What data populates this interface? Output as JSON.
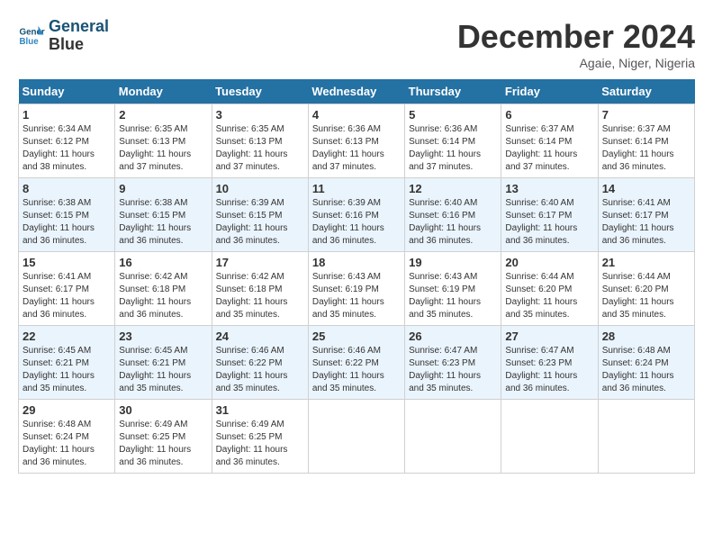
{
  "header": {
    "logo_line1": "General",
    "logo_line2": "Blue",
    "month_title": "December 2024",
    "location": "Agaie, Niger, Nigeria"
  },
  "weekdays": [
    "Sunday",
    "Monday",
    "Tuesday",
    "Wednesday",
    "Thursday",
    "Friday",
    "Saturday"
  ],
  "weeks": [
    [
      {
        "day": "1",
        "sunrise": "6:34 AM",
        "sunset": "6:12 PM",
        "daylight": "11 hours and 38 minutes."
      },
      {
        "day": "2",
        "sunrise": "6:35 AM",
        "sunset": "6:13 PM",
        "daylight": "11 hours and 37 minutes."
      },
      {
        "day": "3",
        "sunrise": "6:35 AM",
        "sunset": "6:13 PM",
        "daylight": "11 hours and 37 minutes."
      },
      {
        "day": "4",
        "sunrise": "6:36 AM",
        "sunset": "6:13 PM",
        "daylight": "11 hours and 37 minutes."
      },
      {
        "day": "5",
        "sunrise": "6:36 AM",
        "sunset": "6:14 PM",
        "daylight": "11 hours and 37 minutes."
      },
      {
        "day": "6",
        "sunrise": "6:37 AM",
        "sunset": "6:14 PM",
        "daylight": "11 hours and 37 minutes."
      },
      {
        "day": "7",
        "sunrise": "6:37 AM",
        "sunset": "6:14 PM",
        "daylight": "11 hours and 36 minutes."
      }
    ],
    [
      {
        "day": "8",
        "sunrise": "6:38 AM",
        "sunset": "6:15 PM",
        "daylight": "11 hours and 36 minutes."
      },
      {
        "day": "9",
        "sunrise": "6:38 AM",
        "sunset": "6:15 PM",
        "daylight": "11 hours and 36 minutes."
      },
      {
        "day": "10",
        "sunrise": "6:39 AM",
        "sunset": "6:15 PM",
        "daylight": "11 hours and 36 minutes."
      },
      {
        "day": "11",
        "sunrise": "6:39 AM",
        "sunset": "6:16 PM",
        "daylight": "11 hours and 36 minutes."
      },
      {
        "day": "12",
        "sunrise": "6:40 AM",
        "sunset": "6:16 PM",
        "daylight": "11 hours and 36 minutes."
      },
      {
        "day": "13",
        "sunrise": "6:40 AM",
        "sunset": "6:17 PM",
        "daylight": "11 hours and 36 minutes."
      },
      {
        "day": "14",
        "sunrise": "6:41 AM",
        "sunset": "6:17 PM",
        "daylight": "11 hours and 36 minutes."
      }
    ],
    [
      {
        "day": "15",
        "sunrise": "6:41 AM",
        "sunset": "6:17 PM",
        "daylight": "11 hours and 36 minutes."
      },
      {
        "day": "16",
        "sunrise": "6:42 AM",
        "sunset": "6:18 PM",
        "daylight": "11 hours and 36 minutes."
      },
      {
        "day": "17",
        "sunrise": "6:42 AM",
        "sunset": "6:18 PM",
        "daylight": "11 hours and 35 minutes."
      },
      {
        "day": "18",
        "sunrise": "6:43 AM",
        "sunset": "6:19 PM",
        "daylight": "11 hours and 35 minutes."
      },
      {
        "day": "19",
        "sunrise": "6:43 AM",
        "sunset": "6:19 PM",
        "daylight": "11 hours and 35 minutes."
      },
      {
        "day": "20",
        "sunrise": "6:44 AM",
        "sunset": "6:20 PM",
        "daylight": "11 hours and 35 minutes."
      },
      {
        "day": "21",
        "sunrise": "6:44 AM",
        "sunset": "6:20 PM",
        "daylight": "11 hours and 35 minutes."
      }
    ],
    [
      {
        "day": "22",
        "sunrise": "6:45 AM",
        "sunset": "6:21 PM",
        "daylight": "11 hours and 35 minutes."
      },
      {
        "day": "23",
        "sunrise": "6:45 AM",
        "sunset": "6:21 PM",
        "daylight": "11 hours and 35 minutes."
      },
      {
        "day": "24",
        "sunrise": "6:46 AM",
        "sunset": "6:22 PM",
        "daylight": "11 hours and 35 minutes."
      },
      {
        "day": "25",
        "sunrise": "6:46 AM",
        "sunset": "6:22 PM",
        "daylight": "11 hours and 35 minutes."
      },
      {
        "day": "26",
        "sunrise": "6:47 AM",
        "sunset": "6:23 PM",
        "daylight": "11 hours and 35 minutes."
      },
      {
        "day": "27",
        "sunrise": "6:47 AM",
        "sunset": "6:23 PM",
        "daylight": "11 hours and 36 minutes."
      },
      {
        "day": "28",
        "sunrise": "6:48 AM",
        "sunset": "6:24 PM",
        "daylight": "11 hours and 36 minutes."
      }
    ],
    [
      {
        "day": "29",
        "sunrise": "6:48 AM",
        "sunset": "6:24 PM",
        "daylight": "11 hours and 36 minutes."
      },
      {
        "day": "30",
        "sunrise": "6:49 AM",
        "sunset": "6:25 PM",
        "daylight": "11 hours and 36 minutes."
      },
      {
        "day": "31",
        "sunrise": "6:49 AM",
        "sunset": "6:25 PM",
        "daylight": "11 hours and 36 minutes."
      },
      null,
      null,
      null,
      null
    ]
  ]
}
